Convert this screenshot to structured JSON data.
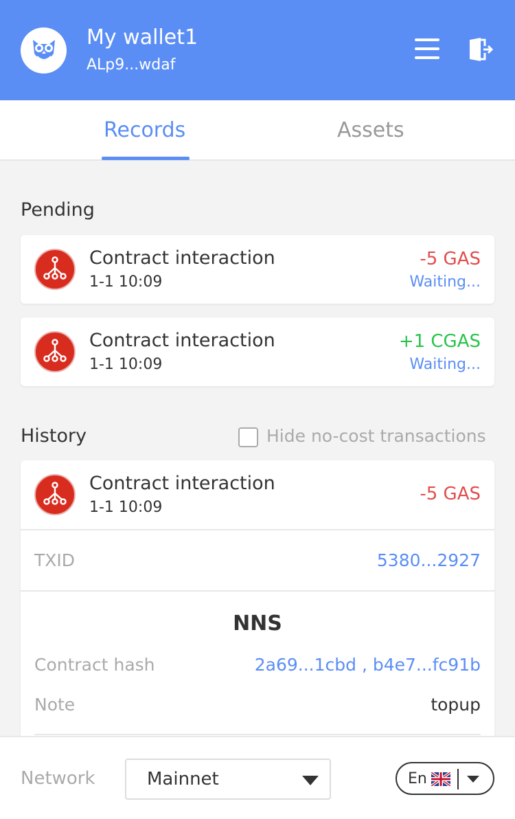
{
  "header": {
    "wallet_name": "My wallet1",
    "wallet_address": "ALp9...wdaf",
    "accent_color": "#5b8ef5"
  },
  "tabs": [
    {
      "label": "Records",
      "active": true
    },
    {
      "label": "Assets",
      "active": false
    }
  ],
  "pending": {
    "title": "Pending",
    "items": [
      {
        "title": "Contract interaction",
        "time": "1-1 10:09",
        "amount": "-5 GAS",
        "status": "Waiting...",
        "icon": "contract-icon"
      },
      {
        "title": "Contract interaction",
        "time": "1-1 10:09",
        "amount": "+1 CGAS",
        "status": "Waiting...",
        "icon": "contract-icon"
      }
    ]
  },
  "history": {
    "title": "History",
    "hide_checkbox_label": "Hide no-cost transactions",
    "item": {
      "title": "Contract interaction",
      "time": "1-1 10:09",
      "amount": "-5 GAS",
      "txid_label": "TXID",
      "txid_value": "5380...2927",
      "contract_title": "NNS",
      "contract_hash_label": "Contract hash",
      "contract_hash_value": "2a69...1cbd , b4e7...fc91b",
      "note_label": "Note",
      "note_value": "topup"
    }
  },
  "footer": {
    "network_label": "Network",
    "network_value": "Mainnet",
    "language": "En"
  }
}
